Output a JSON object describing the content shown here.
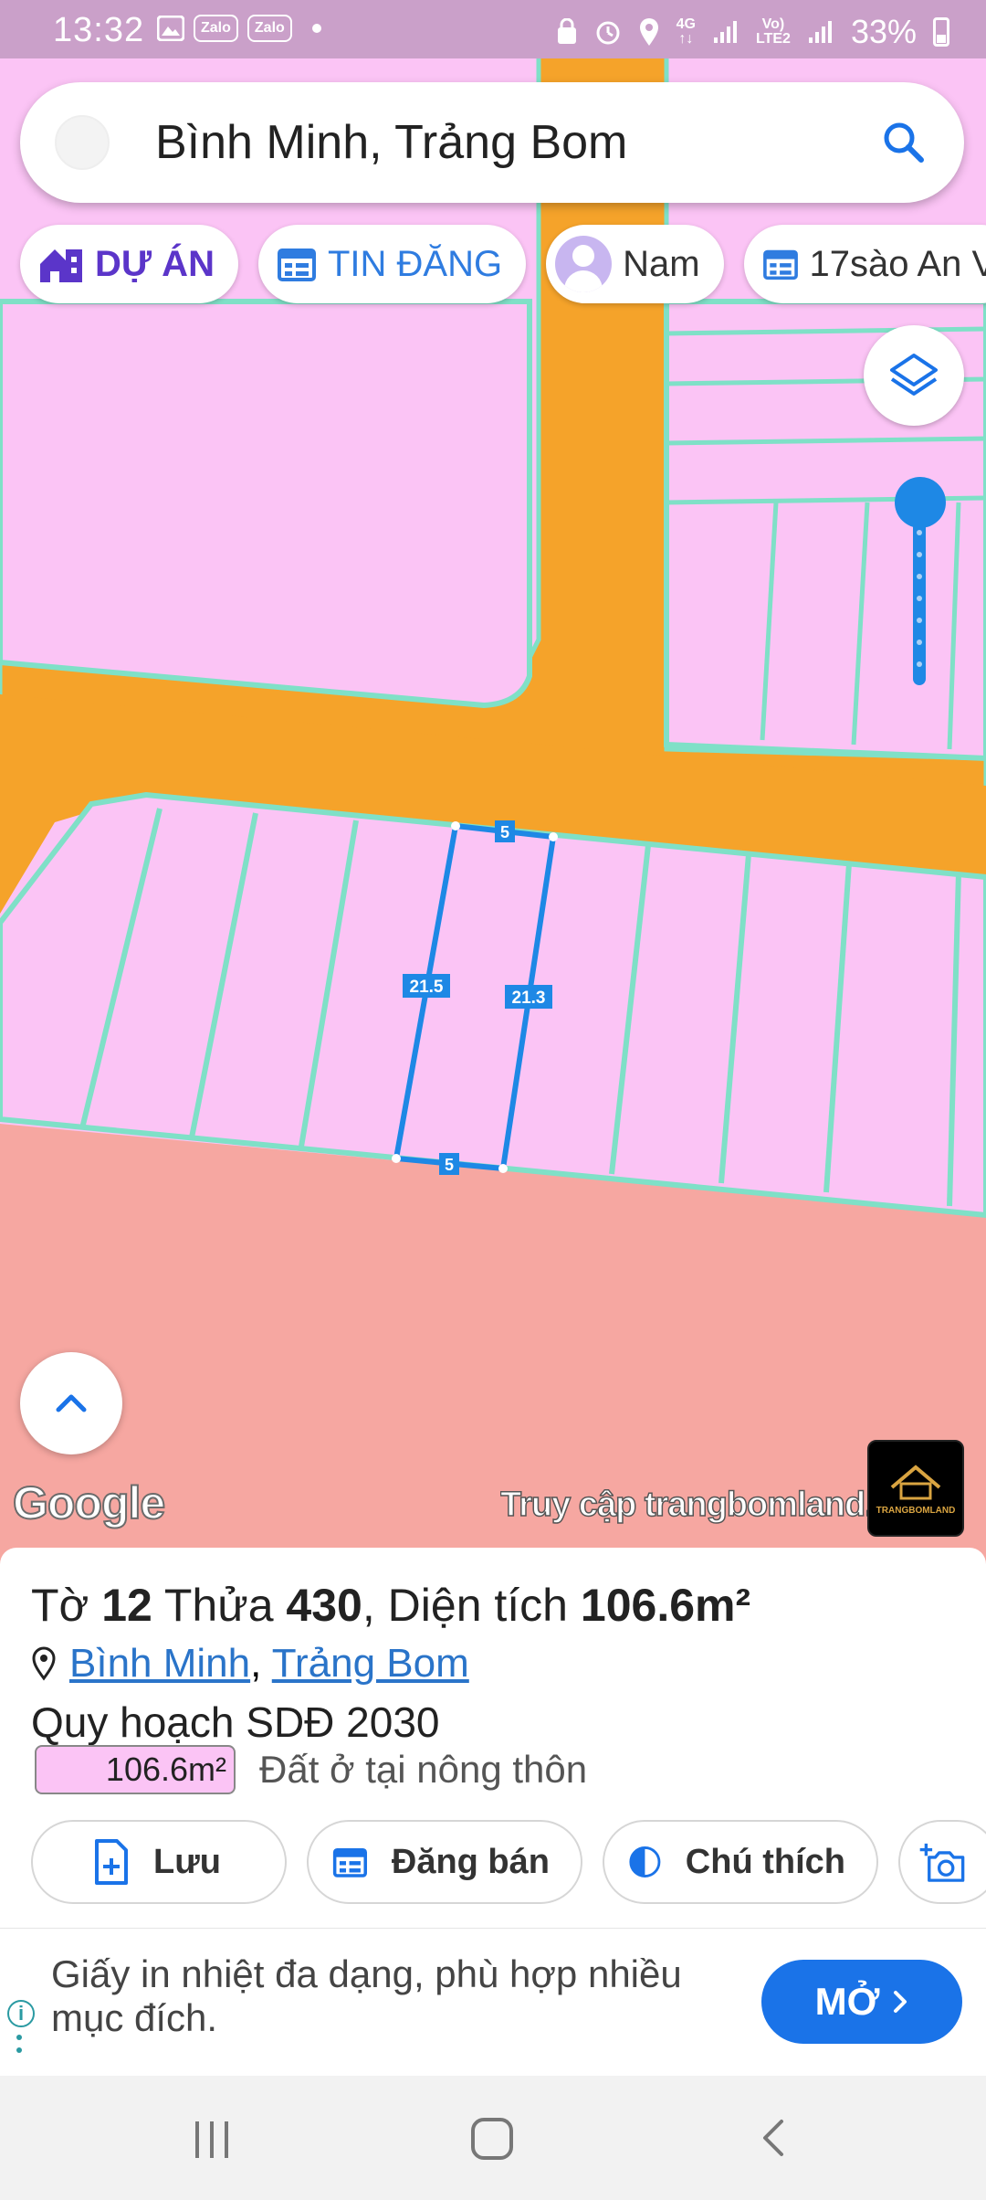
{
  "status_bar": {
    "time": "13:32",
    "left_icons": [
      "image-icon",
      "zalo-icon",
      "zalo-icon",
      "dot"
    ],
    "zalo_label": "Zalo",
    "right_icons": [
      "security-icon",
      "alarm-icon",
      "location-icon",
      "network-4g-icon",
      "signal-icon",
      "volte-icon",
      "signal-icon"
    ],
    "network_label": "4G",
    "volte_label": "Vo)\nLTE2",
    "battery": "33%"
  },
  "search": {
    "text": "Bình Minh, Trảng Bom"
  },
  "chips": {
    "project": "DỰ ÁN",
    "listing": "TIN ĐĂNG",
    "user": "Nam",
    "saved": "17sào An V"
  },
  "map": {
    "parcel_edges": {
      "top": "5",
      "bottom": "5",
      "left": "21.5",
      "right": "21.3"
    },
    "google_logo": "Google",
    "promo_text": "Truy cập trangbomland.c",
    "brand_tile": "TRANGBOMLAND",
    "colors": {
      "residential": "#fbc4f5",
      "road": "#f5a32a",
      "boundary": "#7fe0c7",
      "zone_other": "#f6a7a1",
      "selection": "#1e88e5"
    }
  },
  "sheet": {
    "title_prefix": "Tờ",
    "sheet_no": "12",
    "parcel_word": "Thửa",
    "parcel_no": "430",
    "area_word": "Diện tích",
    "area_value": "106.6m²",
    "locality": "Bình Minh",
    "district": "Trảng Bom",
    "plan_label": "Quy hoạch SDĐ 2030",
    "legend_value": "106.6m²",
    "legend_label": "Đất ở tại nông thôn",
    "actions": {
      "save": "Lưu",
      "sell": "Đăng bán",
      "legend": "Chú thích"
    }
  },
  "ad": {
    "text": "Giấy in nhiệt đa dạng, phù hợp nhiều mục đích.",
    "button": "MỞ"
  }
}
